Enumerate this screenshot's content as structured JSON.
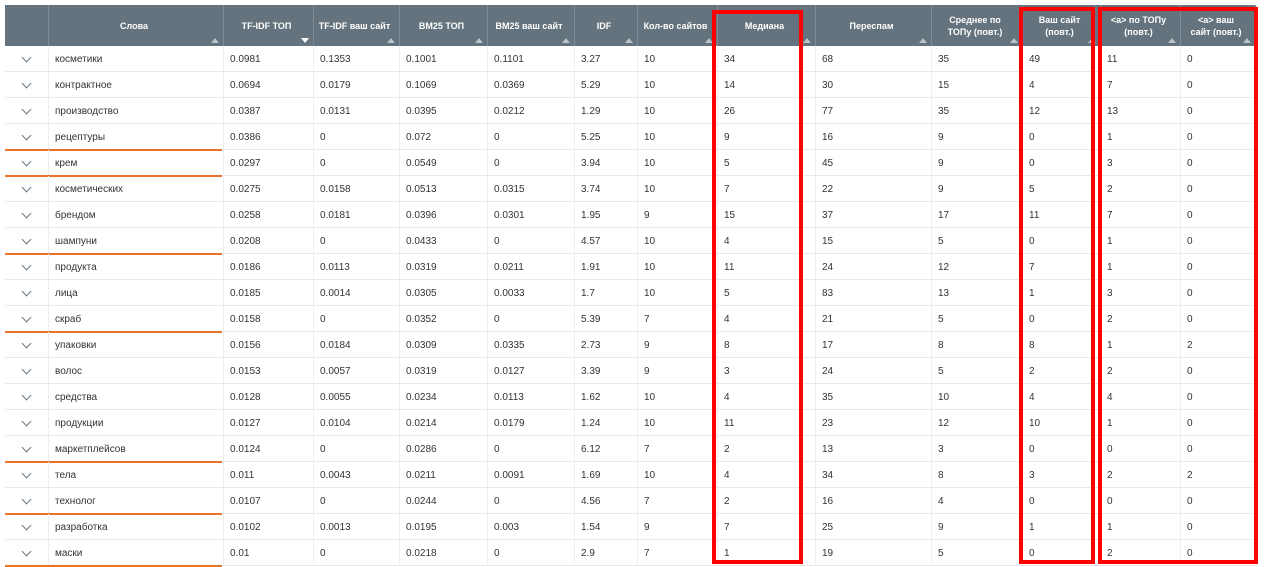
{
  "columns": [
    {
      "label": "",
      "sort": "none"
    },
    {
      "label": "Слова",
      "sort": "asc"
    },
    {
      "label": "TF-IDF ТОП",
      "sort": "desc"
    },
    {
      "label": "TF-IDF ваш сайт",
      "sort": "asc"
    },
    {
      "label": "BM25 ТОП",
      "sort": "asc"
    },
    {
      "label": "BM25 ваш сайт",
      "sort": "asc"
    },
    {
      "label": "IDF",
      "sort": "asc"
    },
    {
      "label": "Кол-во сайтов",
      "sort": "asc"
    },
    {
      "label": "Медиана",
      "sort": "asc"
    },
    {
      "label": "Переспам",
      "sort": "asc"
    },
    {
      "label": "Среднее по ТОПу (повт.)",
      "sort": "asc"
    },
    {
      "label": "Ваш сайт (повт.)",
      "sort": "asc"
    },
    {
      "label": "<a> по ТОПу (повт.)",
      "sort": "asc"
    },
    {
      "label": "<a> ваш сайт (повт.)",
      "sort": "asc"
    }
  ],
  "rows": [
    {
      "word": "косметики",
      "cells": [
        "0.0981",
        "0.1353",
        "0.1001",
        "0.1101",
        "3.27",
        "10",
        "34",
        "68",
        "35",
        "49",
        "11",
        "0"
      ],
      "underline": false
    },
    {
      "word": "контрактное",
      "cells": [
        "0.0694",
        "0.0179",
        "0.1069",
        "0.0369",
        "5.29",
        "10",
        "14",
        "30",
        "15",
        "4",
        "7",
        "0"
      ],
      "underline": false
    },
    {
      "word": "производство",
      "cells": [
        "0.0387",
        "0.0131",
        "0.0395",
        "0.0212",
        "1.29",
        "10",
        "26",
        "77",
        "35",
        "12",
        "13",
        "0"
      ],
      "underline": false
    },
    {
      "word": "рецептуры",
      "cells": [
        "0.0386",
        "0",
        "0.072",
        "0",
        "5.25",
        "10",
        "9",
        "16",
        "9",
        "0",
        "1",
        "0"
      ],
      "underline": true
    },
    {
      "word": "крем",
      "cells": [
        "0.0297",
        "0",
        "0.0549",
        "0",
        "3.94",
        "10",
        "5",
        "45",
        "9",
        "0",
        "3",
        "0"
      ],
      "underline": true
    },
    {
      "word": "косметических",
      "cells": [
        "0.0275",
        "0.0158",
        "0.0513",
        "0.0315",
        "3.74",
        "10",
        "7",
        "22",
        "9",
        "5",
        "2",
        "0"
      ],
      "underline": false
    },
    {
      "word": "брендом",
      "cells": [
        "0.0258",
        "0.0181",
        "0.0396",
        "0.0301",
        "1.95",
        "9",
        "15",
        "37",
        "17",
        "11",
        "7",
        "0"
      ],
      "underline": false
    },
    {
      "word": "шампуни",
      "cells": [
        "0.0208",
        "0",
        "0.0433",
        "0",
        "4.57",
        "10",
        "4",
        "15",
        "5",
        "0",
        "1",
        "0"
      ],
      "underline": true
    },
    {
      "word": "продукта",
      "cells": [
        "0.0186",
        "0.0113",
        "0.0319",
        "0.0211",
        "1.91",
        "10",
        "11",
        "24",
        "12",
        "7",
        "1",
        "0"
      ],
      "underline": false
    },
    {
      "word": "лица",
      "cells": [
        "0.0185",
        "0.0014",
        "0.0305",
        "0.0033",
        "1.7",
        "10",
        "5",
        "83",
        "13",
        "1",
        "3",
        "0"
      ],
      "underline": false
    },
    {
      "word": "скраб",
      "cells": [
        "0.0158",
        "0",
        "0.0352",
        "0",
        "5.39",
        "7",
        "4",
        "21",
        "5",
        "0",
        "2",
        "0"
      ],
      "underline": true
    },
    {
      "word": "упаковки",
      "cells": [
        "0.0156",
        "0.0184",
        "0.0309",
        "0.0335",
        "2.73",
        "9",
        "8",
        "17",
        "8",
        "8",
        "1",
        "2"
      ],
      "underline": false
    },
    {
      "word": "волос",
      "cells": [
        "0.0153",
        "0.0057",
        "0.0319",
        "0.0127",
        "3.39",
        "9",
        "3",
        "24",
        "5",
        "2",
        "2",
        "0"
      ],
      "underline": false
    },
    {
      "word": "средства",
      "cells": [
        "0.0128",
        "0.0055",
        "0.0234",
        "0.0113",
        "1.62",
        "10",
        "4",
        "35",
        "10",
        "4",
        "4",
        "0"
      ],
      "underline": false
    },
    {
      "word": "продукции",
      "cells": [
        "0.0127",
        "0.0104",
        "0.0214",
        "0.0179",
        "1.24",
        "10",
        "11",
        "23",
        "12",
        "10",
        "1",
        "0"
      ],
      "underline": false
    },
    {
      "word": "маркетплейсов",
      "cells": [
        "0.0124",
        "0",
        "0.0286",
        "0",
        "6.12",
        "7",
        "2",
        "13",
        "3",
        "0",
        "0",
        "0"
      ],
      "underline": true
    },
    {
      "word": "тела",
      "cells": [
        "0.011",
        "0.0043",
        "0.0211",
        "0.0091",
        "1.69",
        "10",
        "4",
        "34",
        "8",
        "3",
        "2",
        "2"
      ],
      "underline": false
    },
    {
      "word": "технолог",
      "cells": [
        "0.0107",
        "0",
        "0.0244",
        "0",
        "4.56",
        "7",
        "2",
        "16",
        "4",
        "0",
        "0",
        "0"
      ],
      "underline": true
    },
    {
      "word": "разработка",
      "cells": [
        "0.0102",
        "0.0013",
        "0.0195",
        "0.003",
        "1.54",
        "9",
        "7",
        "25",
        "9",
        "1",
        "1",
        "0"
      ],
      "underline": false
    },
    {
      "word": "маски",
      "cells": [
        "0.01",
        "0",
        "0.0218",
        "0",
        "2.9",
        "7",
        "1",
        "19",
        "5",
        "0",
        "2",
        "0"
      ],
      "underline": true
    }
  ],
  "colors": {
    "header_bg": "#64737d",
    "header_text": "#ffffff",
    "underline_accent": "#e8742a",
    "highlight_box": "#ff0000"
  },
  "icons": {
    "row_toggle": "chevron-down-icon",
    "sort": "sort-arrow-icon"
  }
}
